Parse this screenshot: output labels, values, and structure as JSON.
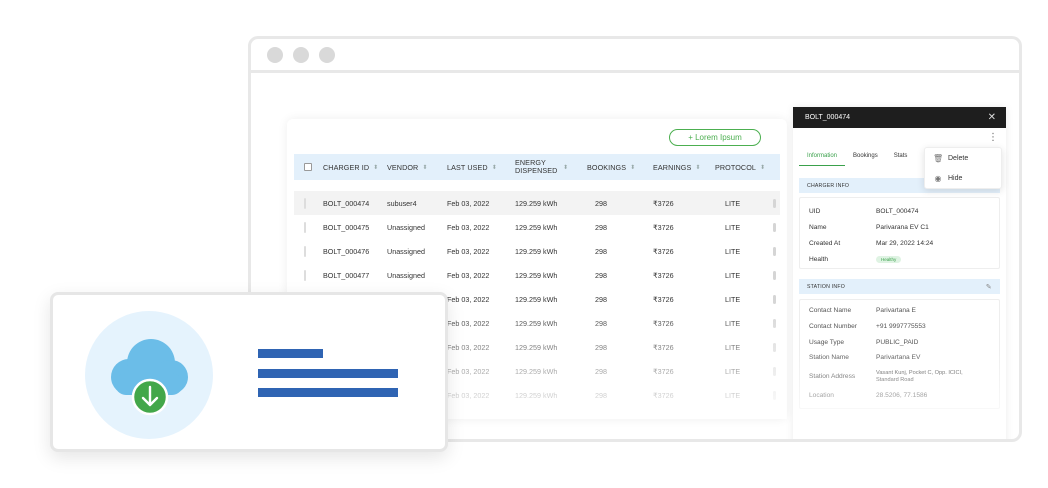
{
  "table": {
    "add_button": "+ Lorem Ipsum",
    "columns": [
      "CHARGER ID",
      "VENDOR",
      "LAST USED",
      "ENERGY DISPENSED",
      "BOOKINGS",
      "EARNINGS",
      "PROTOCOL"
    ],
    "rows": [
      [
        "BOLT_000474",
        "subuser4",
        "Feb 03, 2022",
        "129.259 kWh",
        "298",
        "₹3726",
        "LITE"
      ],
      [
        "BOLT_000475",
        "Unassigned",
        "Feb 03, 2022",
        "129.259 kWh",
        "298",
        "₹3726",
        "LITE"
      ],
      [
        "BOLT_000476",
        "Unassigned",
        "Feb 03, 2022",
        "129.259 kWh",
        "298",
        "₹3726",
        "LITE"
      ],
      [
        "BOLT_000477",
        "Unassigned",
        "Feb 03, 2022",
        "129.259 kWh",
        "298",
        "₹3726",
        "LITE"
      ],
      [
        "",
        "",
        "Feb 03, 2022",
        "129.259 kWh",
        "298",
        "₹3726",
        "LITE"
      ],
      [
        "",
        "",
        "Feb 03, 2022",
        "129.259 kWh",
        "298",
        "₹3726",
        "LITE"
      ],
      [
        "",
        "",
        "Feb 03, 2022",
        "129.259 kWh",
        "298",
        "₹3726",
        "LITE"
      ],
      [
        "",
        "",
        "Feb 03, 2022",
        "129.259 kWh",
        "298",
        "₹3726",
        "LITE"
      ],
      [
        "",
        "",
        "Feb 03, 2022",
        "129.259 kWh",
        "298",
        "₹3726",
        "LITE"
      ]
    ]
  },
  "panel": {
    "title": "BOLT_000474",
    "tabs": [
      "Information",
      "Bookings",
      "Stats"
    ],
    "menu": [
      "Delete",
      "Hide"
    ],
    "charger_info_title": "CHARGER INFO",
    "charger_info": [
      {
        "k": "UID",
        "v": "BOLT_000474"
      },
      {
        "k": "Name",
        "v": "Parivarana EV C1"
      },
      {
        "k": "Created At",
        "v": "Mar 29, 2022 14:24"
      }
    ],
    "health_label": "Health",
    "health_value": "Healthy",
    "station_info_title": "STATION INFO",
    "station_info": [
      {
        "k": "Contact Name",
        "v": "Parivartana E"
      },
      {
        "k": "Contact Number",
        "v": "+91 9997775553"
      },
      {
        "k": "Usage Type",
        "v": "PUBLIC_PAID"
      },
      {
        "k": "Station Name",
        "v": "Parivartana EV"
      },
      {
        "k": "Station Address",
        "v": "Vasant Kunj, Pocket C, Opp. ICICI, Standard Road"
      },
      {
        "k": "Location",
        "v": "28.5206, 77.1586"
      }
    ]
  },
  "colors": {
    "accent_green": "#3aa14b",
    "header_blue": "#e3f0fb",
    "cloud_blue": "#6bbde8",
    "download_green": "#43a74a",
    "text_line_blue": "#2f64b3"
  }
}
